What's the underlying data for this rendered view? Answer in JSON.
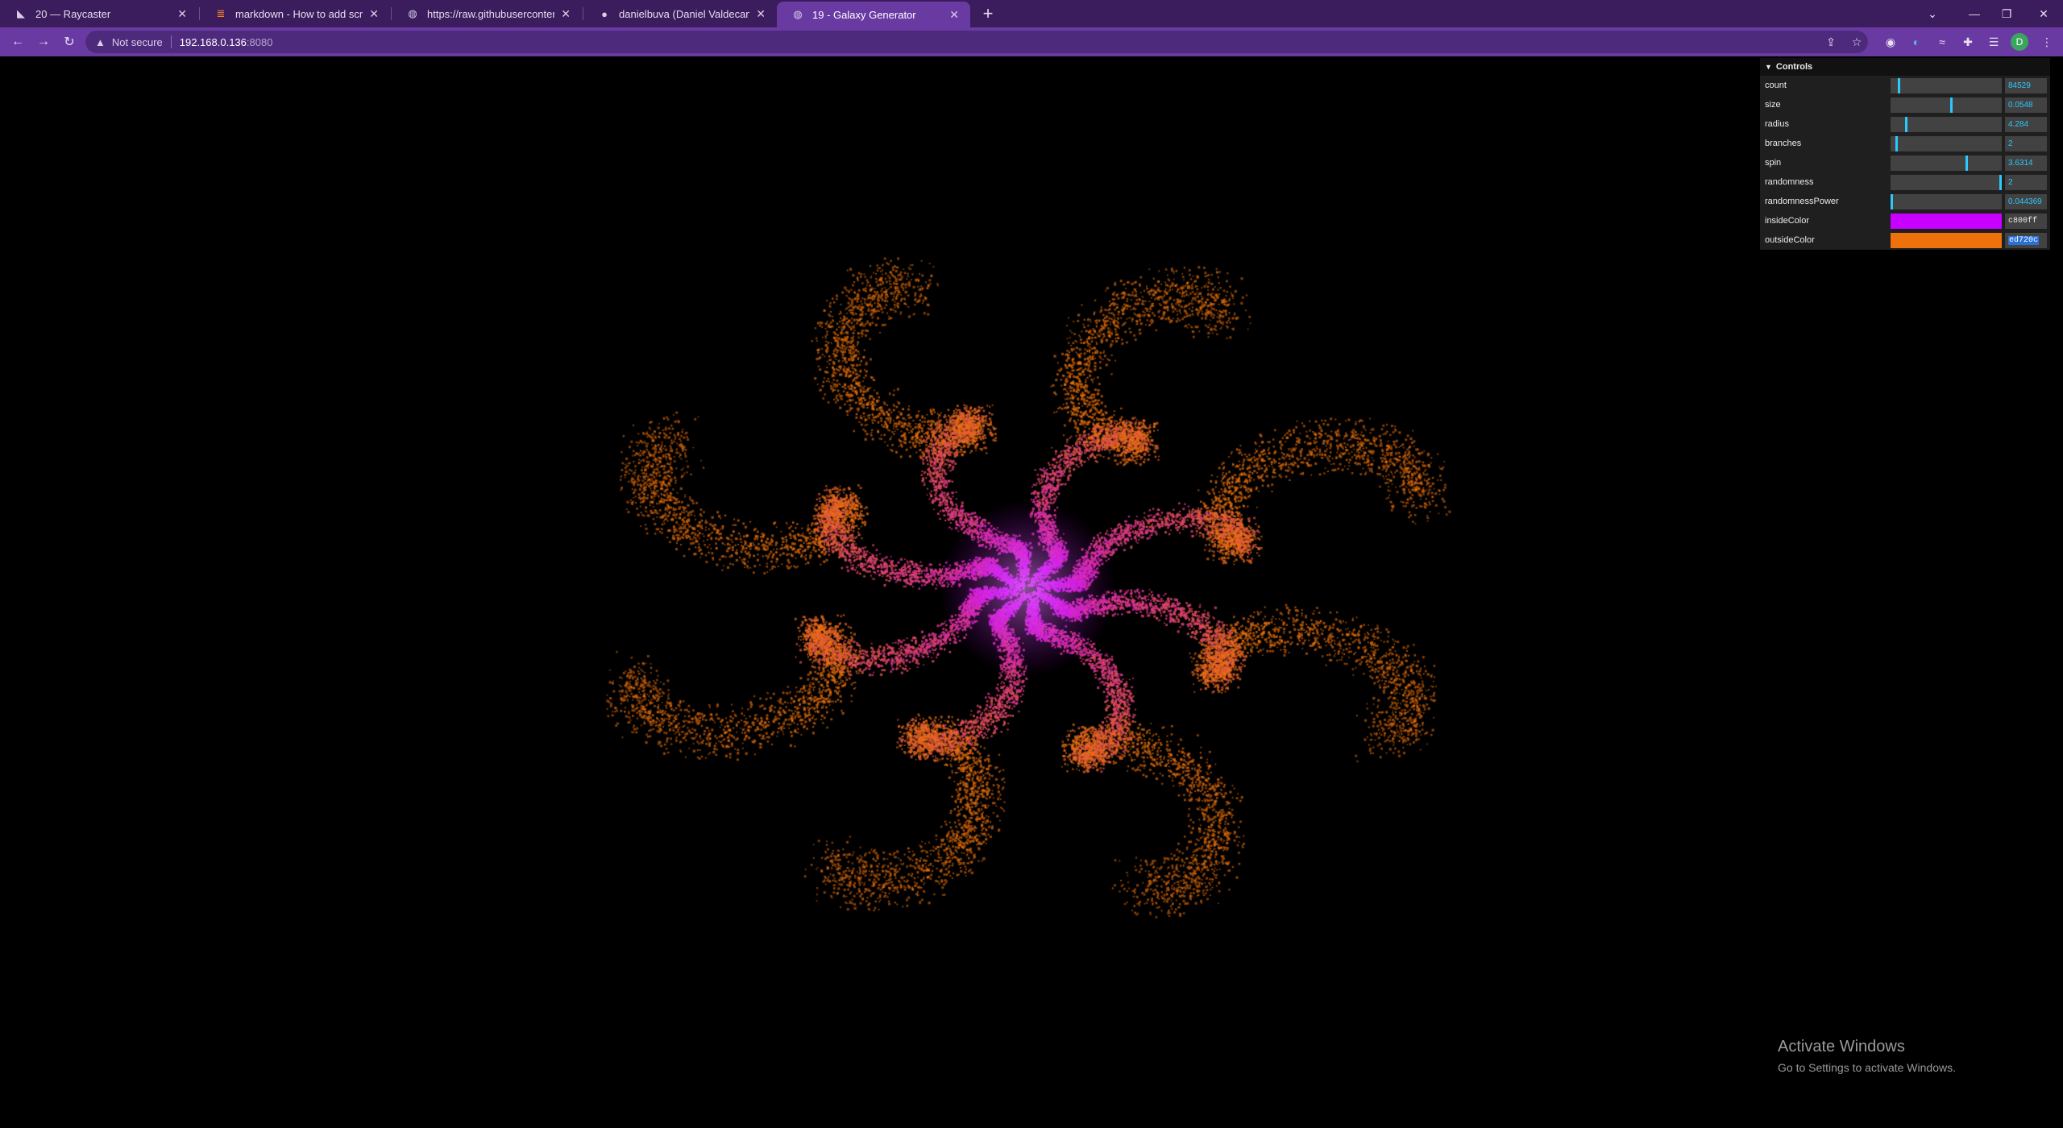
{
  "browser": {
    "tabs": [
      {
        "title": "20 — Raycaster",
        "icon": "threejs-icon",
        "active": false
      },
      {
        "title": "markdown - How to add screens",
        "icon": "stackoverflow-icon",
        "active": false
      },
      {
        "title": "https://raw.githubusercontent.co",
        "icon": "globe-icon",
        "active": false
      },
      {
        "title": "danielbuva (Daniel Valdecantos)",
        "icon": "github-icon",
        "active": false
      },
      {
        "title": "19 - Galaxy Generator",
        "icon": "globe-icon",
        "active": true
      }
    ],
    "security_label": "Not secure",
    "url_host": "192.168.0.136",
    "url_port": ":8080",
    "avatar_initial": "D"
  },
  "gui": {
    "title": "Controls",
    "controls": [
      {
        "name": "count",
        "type": "slider",
        "value": "84529",
        "fraction": 0.07
      },
      {
        "name": "size",
        "type": "slider",
        "value": "0.0548",
        "fraction": 0.54
      },
      {
        "name": "radius",
        "type": "slider",
        "value": "4.284",
        "fraction": 0.14
      },
      {
        "name": "branches",
        "type": "slider",
        "value": "2",
        "fraction": 0.05
      },
      {
        "name": "spin",
        "type": "slider",
        "value": "3.6314",
        "fraction": 0.68
      },
      {
        "name": "randomness",
        "type": "slider",
        "value": "2",
        "fraction": 1.0
      },
      {
        "name": "randomnessPower",
        "type": "slider",
        "value": "0.044369",
        "fraction": 0.0
      },
      {
        "name": "insideColor",
        "type": "color",
        "value": "c800ff",
        "color": "#c800ff"
      },
      {
        "name": "outsideColor",
        "type": "color",
        "value": "ed720c",
        "color": "#ed720c"
      }
    ]
  },
  "watermark": {
    "title": "Activate Windows",
    "subtitle": "Go to Settings to activate Windows."
  },
  "colors": {
    "tab_strip": "#3b1c5c",
    "toolbar": "#6a3aa3",
    "inside": "#c800ff",
    "outside": "#ed720c",
    "gui_accent": "#2cc9ff"
  }
}
